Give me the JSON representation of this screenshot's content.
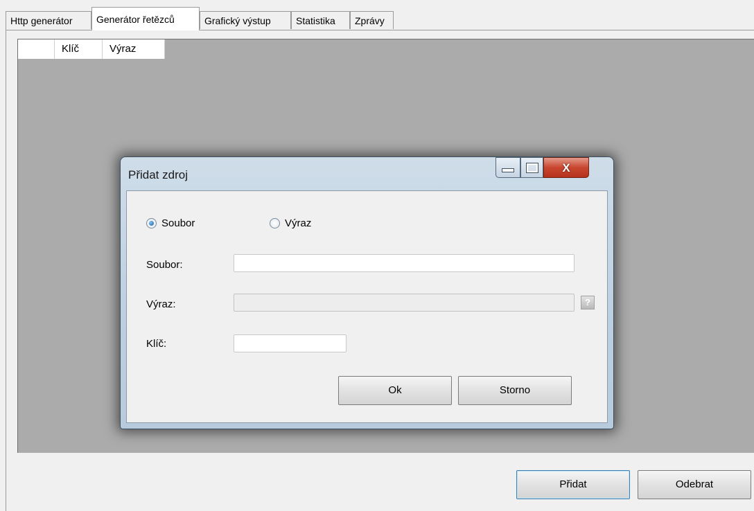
{
  "tabs": [
    {
      "label": "Http generátor"
    },
    {
      "label": "Generátor řetězců"
    },
    {
      "label": "Grafický výstup"
    },
    {
      "label": "Statistika"
    },
    {
      "label": "Zprávy"
    }
  ],
  "active_tab": "Generátor řetězců",
  "grid": {
    "columns": [
      "",
      "Klíč",
      "Výraz"
    ],
    "rows": []
  },
  "buttons": {
    "add_label": "Přidat",
    "remove_label": "Odebrat"
  },
  "dialog": {
    "title": "Přidat zdroj",
    "radio_file_label": "Soubor",
    "radio_expression_label": "Výraz",
    "selected_source": "Soubor",
    "file_label": "Soubor:",
    "file_value": "",
    "expression_label": "Výraz:",
    "expression_value": "",
    "key_label": "Klíč:",
    "key_value": "",
    "help_glyph": "?",
    "ok_label": "Ok",
    "cancel_label": "Storno",
    "close_glyph": "X"
  },
  "colors": {
    "grid_background": "#ababab",
    "close_button": "#c8462f",
    "focus_border": "#3c7fb1"
  },
  "icons": [
    "minimize-icon",
    "maximize-icon",
    "close-icon",
    "help-icon",
    "radio-checked-icon",
    "radio-unchecked-icon"
  ]
}
